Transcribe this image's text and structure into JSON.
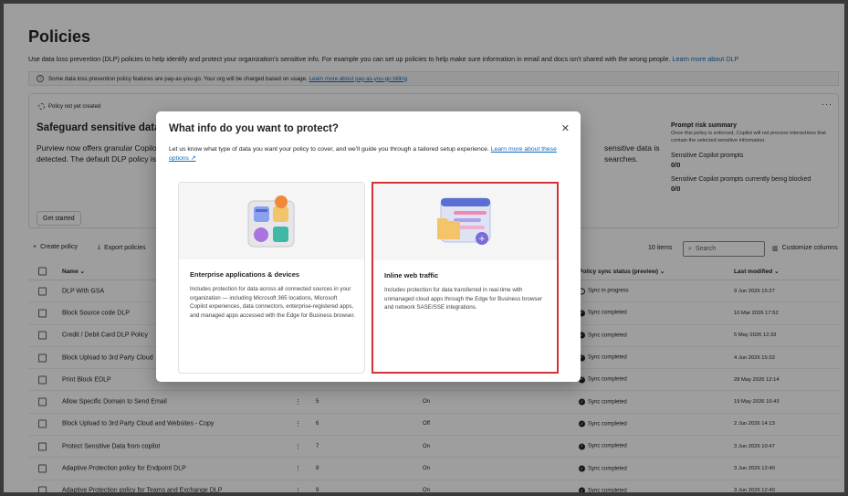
{
  "page": {
    "title": "Policies",
    "description": "Use data loss prevention (DLP) policies to help identify and protect your organization's sensitive info. For example you can set up policies to help make sure information in email and docs isn't shared with the wrong people.",
    "description_link": "Learn more about DLP"
  },
  "banner": {
    "text": "Some data loss prevention policy features are pay-as-you-go. Your org will be charged based on usage.",
    "link": "Learn more about pay-as-you-go billing"
  },
  "card": {
    "status": "Policy not yet created",
    "title": "Safeguard sensitive data in",
    "text_left": [
      "Purview now offers granular Copilot",
      "detected. The default DLP policy is"
    ],
    "text_right": [
      "sensitive data is",
      "searches."
    ],
    "get_started": "Get started",
    "summary": {
      "title": "Prompt risk summary",
      "desc": "Once this policy is enforced, Copilot will not process interactions that contain the selected sensitive information.",
      "label1": "Sensitive Copilot prompts",
      "value1": "0/0",
      "label2": "Sensitive Copilot prompts currently being blocked",
      "value2": "0/0"
    }
  },
  "toolbar": {
    "create": "Create policy",
    "export": "Export policies",
    "items": "10 items",
    "search_placeholder": "Search",
    "customize": "Customize columns"
  },
  "table": {
    "col_name": "Name",
    "col_sync": "Policy sync status (preview)",
    "col_modified": "Last modified",
    "rows": [
      {
        "name": "DLP With GSA",
        "order": "",
        "mode": "",
        "sync": "Sync in progress",
        "date": "9 Jun 2026 15:27",
        "progress": true
      },
      {
        "name": "Block Source code DLP",
        "order": "",
        "mode": "",
        "sync": "Sync completed",
        "date": "10 Mar 2026 17:52",
        "progress": false
      },
      {
        "name": "Credit / Debit Card DLP Policy",
        "order": "",
        "mode": "",
        "sync": "Sync completed",
        "date": "5 May 2026 12:33",
        "progress": false
      },
      {
        "name": "Block Upload to 3rd Party Cloud",
        "order": "",
        "mode": "",
        "sync": "Sync completed",
        "date": "4 Jun 2026 15:33",
        "progress": false
      },
      {
        "name": "Print Block EDLP",
        "order": "",
        "mode": "",
        "sync": "Sync completed",
        "date": "28 May 2026 12:14",
        "progress": false
      },
      {
        "name": "Allow Specific Domain to Send Email",
        "order": "5",
        "mode": "On",
        "sync": "Sync completed",
        "date": "19 May 2026 16:43",
        "progress": false
      },
      {
        "name": "Block Upload to 3rd Party Cloud and Websites - Copy",
        "order": "6",
        "mode": "Off",
        "sync": "Sync completed",
        "date": "2 Jun 2026 14:13",
        "progress": false
      },
      {
        "name": "Protect Sensitive Data from copilot",
        "order": "7",
        "mode": "On",
        "sync": "Sync completed",
        "date": "3 Jun 2026 10:47",
        "progress": false
      },
      {
        "name": "Adaptive Protection policy for Endpoint DLP",
        "order": "8",
        "mode": "On",
        "sync": "Sync completed",
        "date": "3 Jun 2026 12:40",
        "progress": false
      },
      {
        "name": "Adaptive Protection policy for Teams and Exchange DLP",
        "order": "9",
        "mode": "On",
        "sync": "Sync completed",
        "date": "3 Jun 2026 12:40",
        "progress": false
      }
    ]
  },
  "dialog": {
    "title": "What info do you want to protect?",
    "desc": "Let us know what type of data you want your policy to cover, and we'll guide you through a tailored setup experience.",
    "desc_link": "Learn more about these options",
    "options": [
      {
        "title": "Enterprise applications & devices",
        "desc": "Includes protection for data across all connected sources in your organization — including Microsoft 365 locations, Microsoft Copilot experiences, data connectors, enterprise-registered apps, and managed apps accessed with the Edge for Business browser."
      },
      {
        "title": "Inline web traffic",
        "desc": "Includes protection for data transferred in real-time with unmanaged cloud apps through the Edge for Business browser and network SASE/SSE integrations."
      }
    ]
  },
  "colors": {
    "accent": "#0f6cbd",
    "highlight": "#d13438"
  }
}
